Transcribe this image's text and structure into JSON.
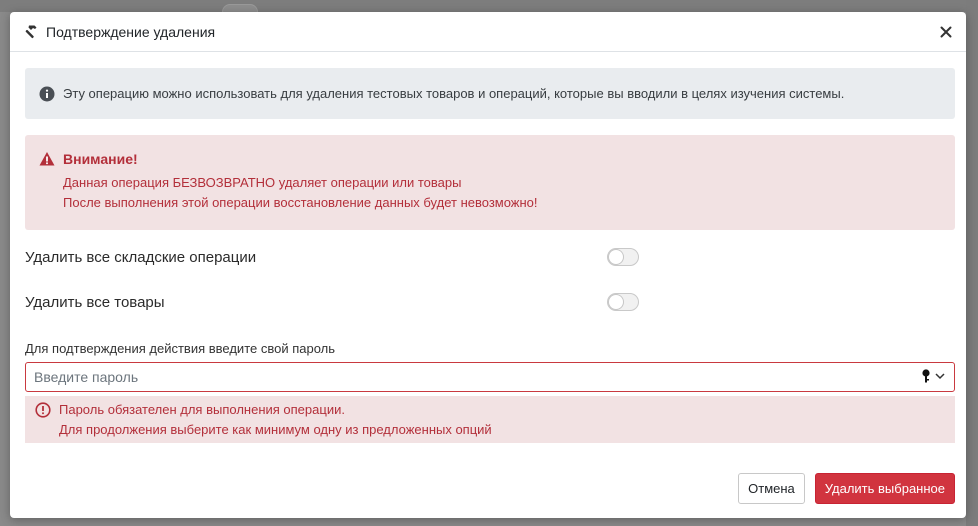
{
  "modal": {
    "title": "Подтверждение удаления",
    "info_text": "Эту операцию можно использовать для удаления тестовых товаров и операций, которые вы вводили в целях изучения системы.",
    "warning": {
      "title": "Внимание!",
      "lines": [
        "Данная операция БЕЗВОЗВРАТНО удаляет операции или товары",
        "После выполнения этой операции восстановление данных будет невозможно!"
      ]
    },
    "options": [
      {
        "label": "Удалить все складские операции",
        "enabled": false
      },
      {
        "label": "Удалить все товары",
        "enabled": false
      }
    ],
    "password": {
      "label": "Для подтверждения действия введите свой пароль",
      "placeholder": "Введите пароль",
      "value": ""
    },
    "errors": [
      "Пароль обязателен для выполнения операции.",
      "Для продолжения выберите как минимум одну из предложенных опций"
    ],
    "buttons": {
      "cancel": "Отмена",
      "delete": "Удалить выбранное"
    }
  },
  "icons": {
    "header": "hammer-icon",
    "close": "close-icon",
    "info": "info-circle-icon",
    "warning": "warning-triangle-icon",
    "key": "key-icon",
    "chevron": "chevron-down-icon",
    "error": "exclamation-circle-icon"
  },
  "colors": {
    "danger": "#d1343f",
    "danger_text": "#b32f3a",
    "danger_bg": "#f2e2e3",
    "info_bg": "#e9ecef"
  }
}
